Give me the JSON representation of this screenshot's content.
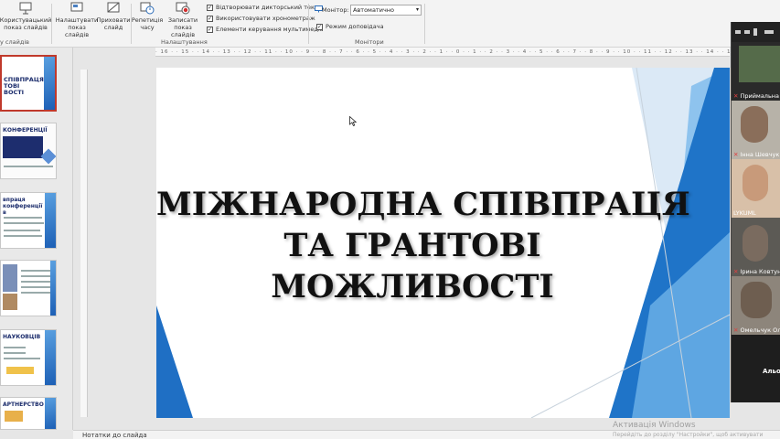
{
  "ribbon": {
    "custom_show": "Користувацький\nпоказ слайдів",
    "custom_show_group_partial": "у слайдів",
    "setup_show": "Налаштувати\nпоказ слайдів",
    "hide_slide": "Приховати\nслайд",
    "rehearse": "Репетиція\nчасу",
    "record": "Записати показ\nслайдів",
    "setup_group": "Налаштування",
    "checkboxes": [
      {
        "label": "Відтворювати дикторський текст",
        "checked": true
      },
      {
        "label": "Використовувати хронометраж",
        "checked": true
      },
      {
        "label": "Елементи керування мультимедіа",
        "checked": true
      }
    ],
    "monitor_label": "Монітор:",
    "monitor_value": "Автоматично",
    "presenter_view": "Режим доповідача",
    "presenter_checked": true,
    "monitors_group": "Монітори"
  },
  "thumbnails": [
    {
      "title": "СПІВПРАЦЯ\nТОВІ\nВОСТІ",
      "selected": true
    },
    {
      "title": "КОНФЕРЕНЦІЇ",
      "selected": false
    },
    {
      "title": "впраця конференції в",
      "selected": false
    },
    {
      "title": "",
      "selected": false
    },
    {
      "title": "НАУКОВЦІВ",
      "selected": false
    },
    {
      "title": "АРТНЕРСТВО",
      "selected": false
    }
  ],
  "ruler_text": "· 16 · · 15 · · 14 · · 13 · · 12 · · 11 · · 10 · · 9 · · 8 · · 7 · · 6 · · 5 · · 4 · · 3 · · 2 · · 1 · · 0 · · 1 · · 2 · · 3 · · 4 · · 5 · · 6 · · 7 · · 8 · · 9 · · 10 · · 11 · · 12 · · 13 · · 14 · · 15 · · 16 ·",
  "slide": {
    "title_lines": [
      "МІЖНАРОДНА СПІВПРАЦЯ",
      "ТА ГРАНТОВІ",
      "МОЖЛИВОСТІ"
    ]
  },
  "notes_label": "Нотатки до слайда",
  "watermark": {
    "line1": "Активація Windows",
    "line2": "Перейдіть до розділу \"Настройки\", щоб активувати"
  },
  "zoom": {
    "participants": [
      "Приймальна",
      "Інна Шевчук",
      "LYKUML",
      "Ірина Ковтун",
      "Омельчук Ол"
    ],
    "bottom_label": "Альо"
  },
  "colors": {
    "accent_blue": "#1f74c8",
    "light_blue": "#6fb0e8"
  }
}
